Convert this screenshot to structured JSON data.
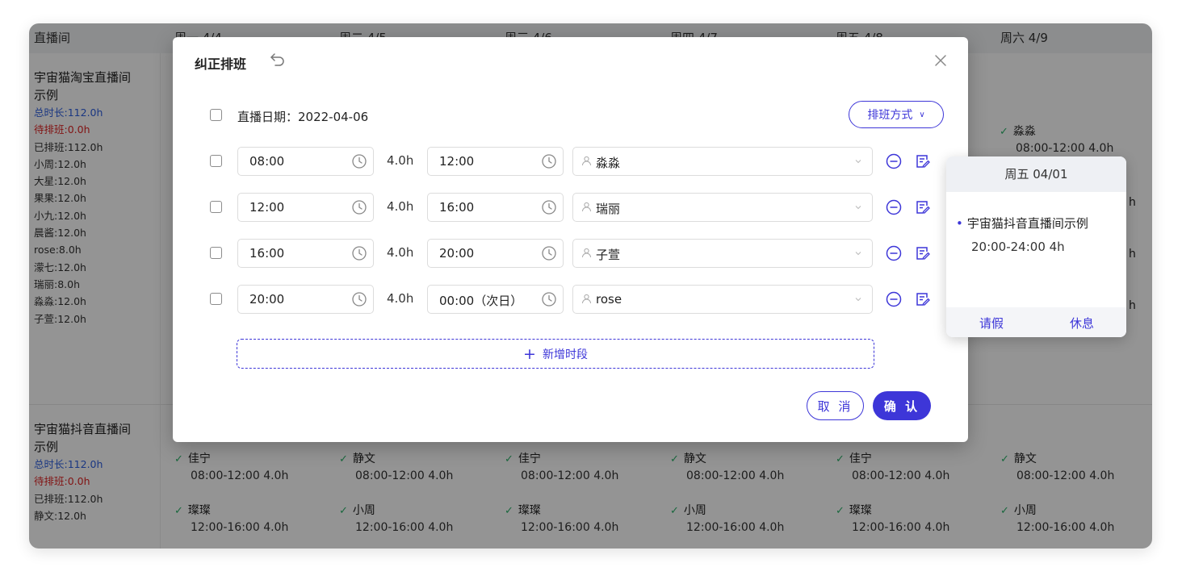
{
  "header": {
    "corner": "直播间",
    "days": [
      "周一 4/4",
      "周二 4/5",
      "周三 4/6",
      "周四 4/7",
      "周五 4/8",
      "周六 4/9"
    ]
  },
  "rooms": [
    {
      "name_line1": "宇宙猫淘宝直播间",
      "name_line2": "示例",
      "total": "总时长:112.0h",
      "pending": "待排班:0.0h",
      "scheduled": "已排班:112.0h",
      "people": [
        "小周:12.0h",
        "大星:12.0h",
        "果果:12.0h",
        "小九:12.0h",
        "晨酱:12.0h",
        "rose:8.0h",
        "濛七:12.0h",
        "瑞丽:8.0h",
        "淼淼:12.0h",
        "子萱:12.0h"
      ]
    },
    {
      "name_line1": "宇宙猫抖音直播间",
      "name_line2": "示例",
      "total": "总时长:112.0h",
      "pending": "待排班:0.0h",
      "scheduled": "已排班:112.0h",
      "people": [
        "静文:12.0h"
      ]
    }
  ],
  "background_cells": {
    "saturday_room1": {
      "name": "淼淼",
      "time": "08:00-12:00 4.0h"
    },
    "room2_slot1": [
      {
        "name": "佳宁",
        "time": "08:00-12:00 4.0h"
      },
      {
        "name": "静文",
        "time": "08:00-12:00 4.0h"
      },
      {
        "name": "佳宁",
        "time": "08:00-12:00 4.0h"
      },
      {
        "name": "静文",
        "time": "08:00-12:00 4.0h"
      },
      {
        "name": "佳宁",
        "time": "08:00-12:00 4.0h"
      },
      {
        "name": "静文",
        "time": "08:00-12:00 4.0h"
      }
    ],
    "room2_slot2": [
      {
        "name": "璨璨",
        "time": "12:00-16:00 4.0h"
      },
      {
        "name": "小周",
        "time": "12:00-16:00 4.0h"
      },
      {
        "name": "璨璨",
        "time": "12:00-16:00 4.0h"
      },
      {
        "name": "小周",
        "time": "12:00-16:00 4.0h"
      },
      {
        "name": "璨璨",
        "time": "12:00-16:00 4.0h"
      },
      {
        "name": "小周",
        "time": "12:00-16:00 4.0h"
      }
    ],
    "right_edge_fragments": [
      "h",
      "h",
      "h"
    ]
  },
  "modal": {
    "title": "纠正排班",
    "date_label": "直播日期：2022-04-06",
    "mode_button": "排班方式",
    "rows": [
      {
        "start": "08:00",
        "duration": "4.0h",
        "end": "12:00",
        "person": "淼淼"
      },
      {
        "start": "12:00",
        "duration": "4.0h",
        "end": "16:00",
        "person": "瑞丽"
      },
      {
        "start": "16:00",
        "duration": "4.0h",
        "end": "20:00",
        "person": "子萱"
      },
      {
        "start": "20:00",
        "duration": "4.0h",
        "end": "00:00（次日）",
        "person": "rose"
      }
    ],
    "add_label": "新增时段",
    "cancel_label": "取 消",
    "confirm_label": "确 认"
  },
  "popover": {
    "title": "周五 04/01",
    "room": "宇宙猫抖音直播间示例",
    "time": "20:00-24:00  4h",
    "leave": "请假",
    "rest": "休息"
  },
  "colors": {
    "accent": "#3d36d8",
    "check": "#2db36b",
    "total": "#2e5fe0",
    "pending": "#e02525"
  },
  "icons": [
    "undo-icon",
    "close-icon",
    "clock-icon",
    "user-icon",
    "chevron-down-icon",
    "minus-circle-icon",
    "edit-note-icon",
    "plus-icon",
    "check-icon"
  ]
}
